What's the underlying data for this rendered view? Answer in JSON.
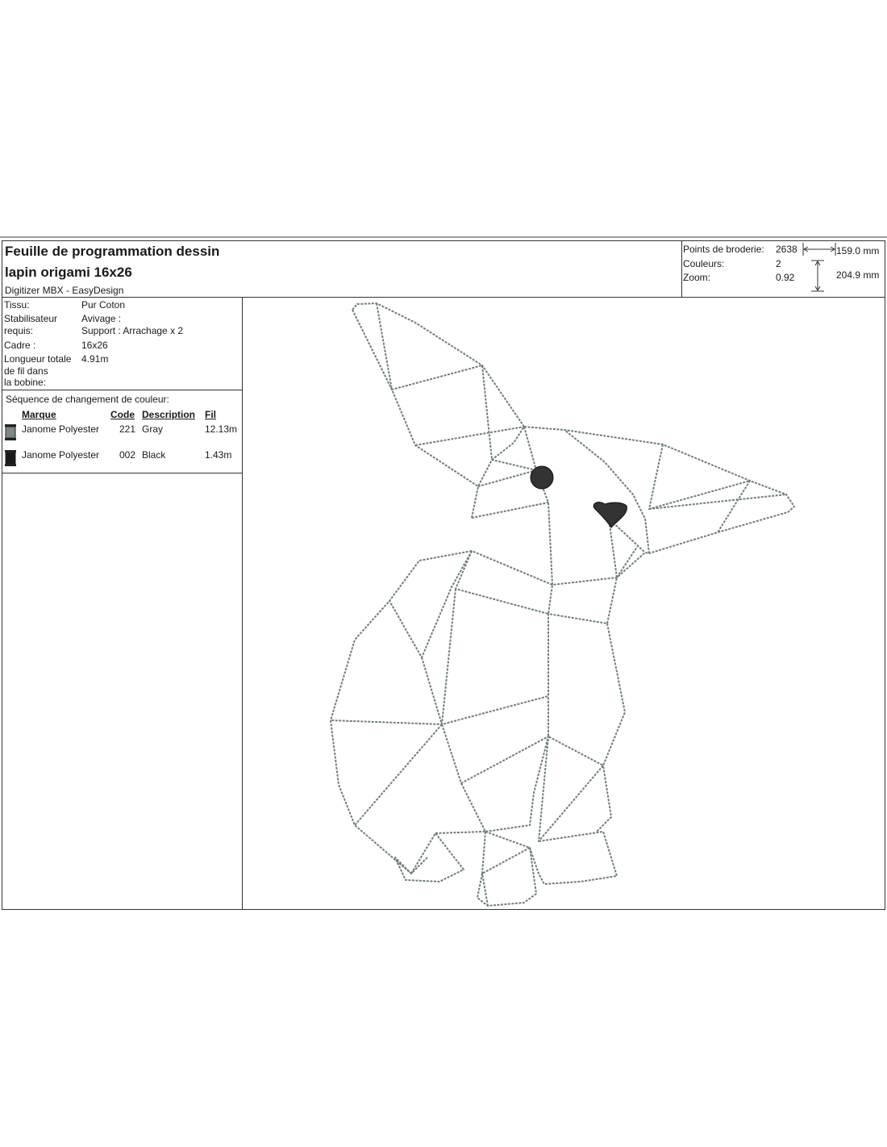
{
  "header": {
    "title_line1": "Feuille de programmation dessin",
    "title_line2": "lapin origami 16x26",
    "software": "Digitizer MBX - EasyDesign"
  },
  "info": {
    "points_label": "Points de broderie:",
    "points_value": "2638",
    "colors_label": "Couleurs:",
    "colors_value": "2",
    "zoom_label": "Zoom:",
    "zoom_value": "0.92",
    "width": "159.0 mm",
    "height": "204.9 mm"
  },
  "details": {
    "fabric_label": "Tissu:",
    "fabric_value": "Pur Coton",
    "stabilizer_label_1": "Stabilisateur",
    "stabilizer_label_2": "requis:",
    "stabilizer_value_1": "Avivage :",
    "stabilizer_value_2": "Support : Arrachage x 2",
    "frame_label": "Cadre :",
    "frame_value": "16x26",
    "thread_label_1": "Longueur totale",
    "thread_label_2": "de fil dans",
    "thread_label_3": "la bobine:",
    "thread_value": "4.91m"
  },
  "color_sequence": {
    "title": "Séquence de changement de couleur:",
    "headers": {
      "brand": "Marque",
      "code": "Code",
      "description": "Description",
      "thread": "Fil"
    },
    "rows": [
      {
        "brand": "Janome Polyester",
        "code": "221",
        "description": "Gray",
        "thread": "12.13m",
        "color": "#7c8a84"
      },
      {
        "brand": "Janome Polyester",
        "code": "002",
        "description": "Black",
        "thread": "1.43m",
        "color": "#1a1a1a"
      }
    ]
  },
  "design": {
    "stitch_color": "#6f7f78",
    "accent_color": "#333333"
  }
}
